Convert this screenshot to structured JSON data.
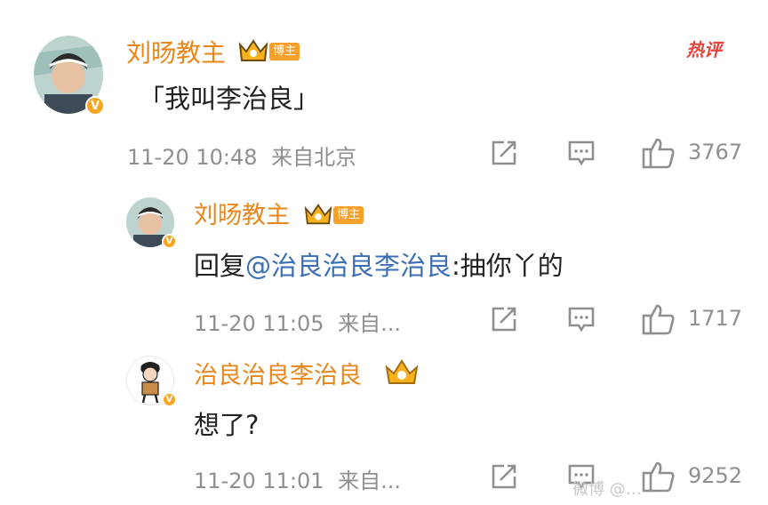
{
  "header": {
    "hot_label": "热评"
  },
  "comment": {
    "username": "刘旸教主",
    "tag": "博主",
    "text": "「我叫李治良」",
    "timestamp": "11-20 10:48",
    "source": "来自北京",
    "likes": "3767"
  },
  "replies": [
    {
      "username": "刘旸教主",
      "tag": "博主",
      "prefix": "回复",
      "mention": "@治良治良李治良",
      "suffix": ":抽你丫的",
      "timestamp": "11-20 11:05",
      "source": "来自...",
      "likes": "1717"
    },
    {
      "username": "治良治良李治良",
      "text": "想了?",
      "timestamp": "11-20 11:01",
      "source": "来自...",
      "likes": "9252"
    }
  ],
  "watermark": "微博 @…",
  "colors": {
    "username": "#e8861a",
    "mention": "#3a6fb5",
    "meta": "#8f8f8f",
    "hot": "#e8433a",
    "badge": "#f6a623"
  },
  "icons": [
    "verified-v-icon",
    "crown-icon",
    "share-icon",
    "comment-icon",
    "thumbs-up-icon"
  ]
}
